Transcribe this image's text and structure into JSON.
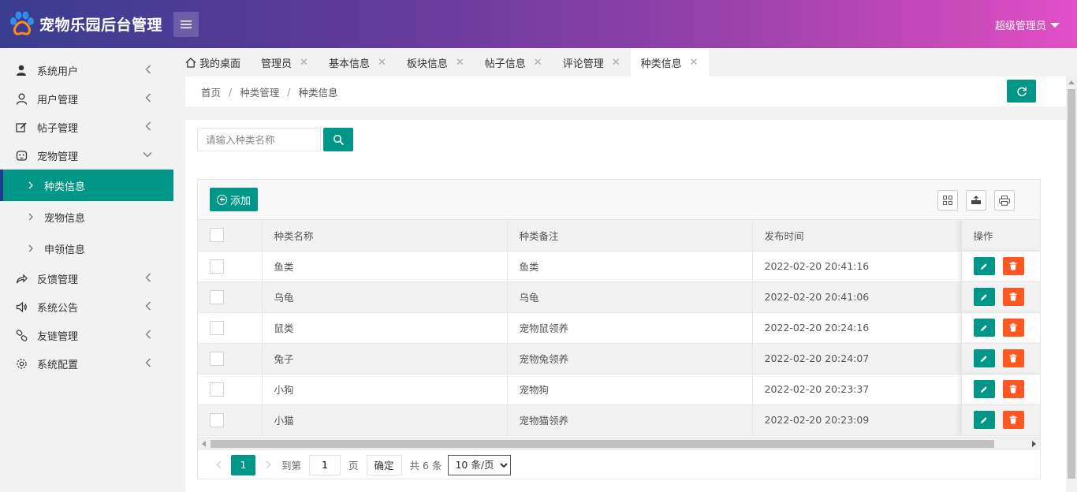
{
  "app": {
    "title": "宠物乐园后台管理"
  },
  "header": {
    "user_label": "超级管理员"
  },
  "sidebar": {
    "items": [
      {
        "label": "系统用户",
        "icon": "user-solid-icon"
      },
      {
        "label": "用户管理",
        "icon": "user-outline-icon"
      },
      {
        "label": "帖子管理",
        "icon": "edit-icon"
      },
      {
        "label": "宠物管理",
        "icon": "pet-face-icon",
        "expanded": true,
        "children": [
          {
            "label": "种类信息",
            "active": true
          },
          {
            "label": "宠物信息"
          },
          {
            "label": "申领信息"
          }
        ]
      },
      {
        "label": "反馈管理",
        "icon": "share-icon"
      },
      {
        "label": "系统公告",
        "icon": "speaker-icon"
      },
      {
        "label": "友链管理",
        "icon": "link-icon"
      },
      {
        "label": "系统配置",
        "icon": "gear-icon"
      }
    ]
  },
  "tabs": [
    {
      "label": "我的桌面",
      "icon": "home-icon"
    },
    {
      "label": "管理员"
    },
    {
      "label": "基本信息"
    },
    {
      "label": "板块信息"
    },
    {
      "label": "帖子信息"
    },
    {
      "label": "评论管理"
    },
    {
      "label": "种类信息",
      "active": true
    }
  ],
  "breadcrumb": {
    "home": "首页",
    "section": "种类管理",
    "current": "种类信息",
    "separator": "/"
  },
  "search": {
    "placeholder": "请输入种类名称"
  },
  "toolbar": {
    "add_label": "添加"
  },
  "table": {
    "columns": {
      "name": "种类名称",
      "note": "种类备注",
      "time": "发布时间",
      "ops": "操作"
    },
    "rows": [
      {
        "name": "鱼类",
        "note": "鱼类",
        "time": "2022-02-20 20:41:16"
      },
      {
        "name": "乌龟",
        "note": "乌龟",
        "time": "2022-02-20 20:41:06"
      },
      {
        "name": "鼠类",
        "note": "宠物鼠领养",
        "time": "2022-02-20 20:24:16"
      },
      {
        "name": "兔子",
        "note": "宠物兔领养",
        "time": "2022-02-20 20:24:07"
      },
      {
        "name": "小狗",
        "note": "宠物狗",
        "time": "2022-02-20 20:23:37"
      },
      {
        "name": "小猫",
        "note": "宠物猫领养",
        "time": "2022-02-20 20:23:09"
      }
    ]
  },
  "pager": {
    "current_page": "1",
    "goto_label": "到第",
    "goto_value": "1",
    "page_suffix": "页",
    "confirm_label": "确定",
    "total_label": "共 6 条",
    "page_size_label": "10 条/页"
  },
  "colors": {
    "primary": "#009688",
    "danger": "#ff5722",
    "header_start": "#3a3d8f",
    "header_end": "#e24fc6"
  }
}
